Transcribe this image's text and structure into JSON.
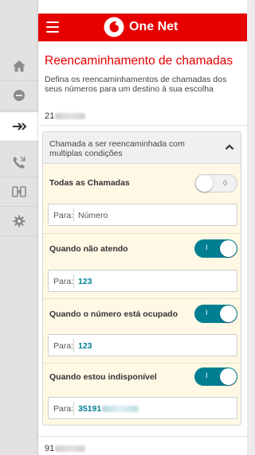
{
  "app": {
    "title": "One Net"
  },
  "header": {
    "menu_icon": "hamburger-menu-icon",
    "logo_icon": "vodafone-logo-icon"
  },
  "rail": {
    "items": [
      {
        "icon": "home-icon"
      },
      {
        "icon": "minus-circle-icon"
      },
      {
        "icon": "call-forward-icon",
        "active": true
      },
      {
        "icon": "call-handset-icon"
      },
      {
        "icon": "device-transfer-icon"
      },
      {
        "icon": "settings-gear-icon"
      }
    ]
  },
  "page": {
    "title": "Reencaminhamento de chamadas",
    "description": "Defina os reencaminhamentos de chamadas dos seus números para um destino à sua escolha"
  },
  "number_1": {
    "prefix": "21"
  },
  "accordion": {
    "header": "Chamada a ser reencaminhada com multiplas condições",
    "rules": [
      {
        "title": "Todas as Chamadas",
        "toggle_state": "0",
        "enabled": false,
        "field_label": "Para:",
        "field_placeholder": "Número",
        "field_value": ""
      },
      {
        "title": "Quando não atendo",
        "toggle_state": "I",
        "enabled": true,
        "field_label": "Para:",
        "field_placeholder": "",
        "field_value": "123"
      },
      {
        "title": "Quando o número está ocupado",
        "toggle_state": "I",
        "enabled": true,
        "field_label": "Para:",
        "field_placeholder": "",
        "field_value": "123"
      },
      {
        "title": "Quando estou indisponível",
        "toggle_state": "I",
        "enabled": true,
        "field_label": "Para:",
        "field_placeholder": "",
        "field_value": "35191"
      }
    ]
  },
  "number_2": {
    "prefix": "91"
  },
  "colors": {
    "brand_red": "#e60000",
    "toggle_on": "#007e92",
    "panel_bg": "#fff8e5"
  }
}
